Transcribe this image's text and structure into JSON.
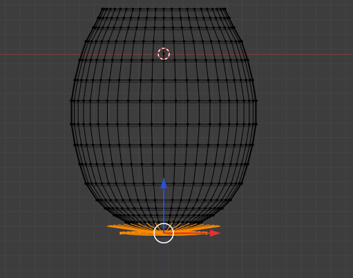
{
  "viewport": {
    "mode": "edit-mode",
    "view": "front-orthographic",
    "background_color": "#3d3d3d",
    "grid_color": "#454545",
    "x_axis_line_color": "#8a3b3b",
    "z_axis_line_color": "#2b3f7a"
  },
  "mesh": {
    "name": "egg-shaped mesh",
    "wire_color": "#000000",
    "vertex_color": "#000000",
    "selected_color": "#ff8a00"
  },
  "cursor_3d": {
    "icon": "crosshair-ring-icon",
    "ring_colors": [
      "#ffffff",
      "#e03030"
    ]
  },
  "transform_gizmo": {
    "x_arrow_color": "#e83030",
    "z_arrow_color": "#2a4fd8",
    "handle_color": "#ffffff"
  }
}
